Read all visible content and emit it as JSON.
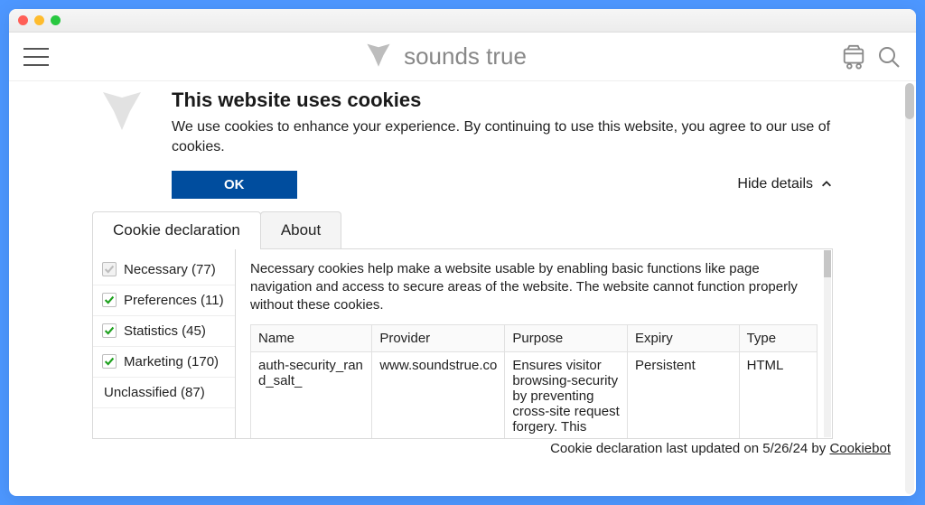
{
  "brand_name": "sounds true",
  "cookie": {
    "title": "This website uses cookies",
    "body": "We use cookies to enhance your experience. By continuing to use this website, you agree to our use of cookies.",
    "ok_label": "OK",
    "hide_details_label": "Hide details",
    "tabs": {
      "declaration": "Cookie declaration",
      "about": "About"
    },
    "categories": [
      {
        "label": "Necessary (77)",
        "state": "disabled"
      },
      {
        "label": "Preferences (11)",
        "state": "checked"
      },
      {
        "label": "Statistics (45)",
        "state": "checked"
      },
      {
        "label": "Marketing (170)",
        "state": "checked"
      },
      {
        "label": "Unclassified (87)",
        "state": "plain"
      }
    ],
    "category_description": "Necessary cookies help make a website usable by enabling basic functions like page navigation and access to secure areas of the website. The website cannot function properly without these cookies.",
    "table": {
      "headers": {
        "name": "Name",
        "provider": "Provider",
        "purpose": "Purpose",
        "expiry": "Expiry",
        "type": "Type"
      },
      "row": {
        "name": "auth-security_rand_salt_",
        "provider": "www.soundstrue.co",
        "purpose": "Ensures visitor browsing-security by preventing cross-site request forgery. This",
        "expiry": "Persistent",
        "type": "HTML"
      }
    },
    "footer": {
      "text_prefix": "Cookie declaration last updated on 5/26/24 by ",
      "link": "Cookiebot"
    }
  }
}
